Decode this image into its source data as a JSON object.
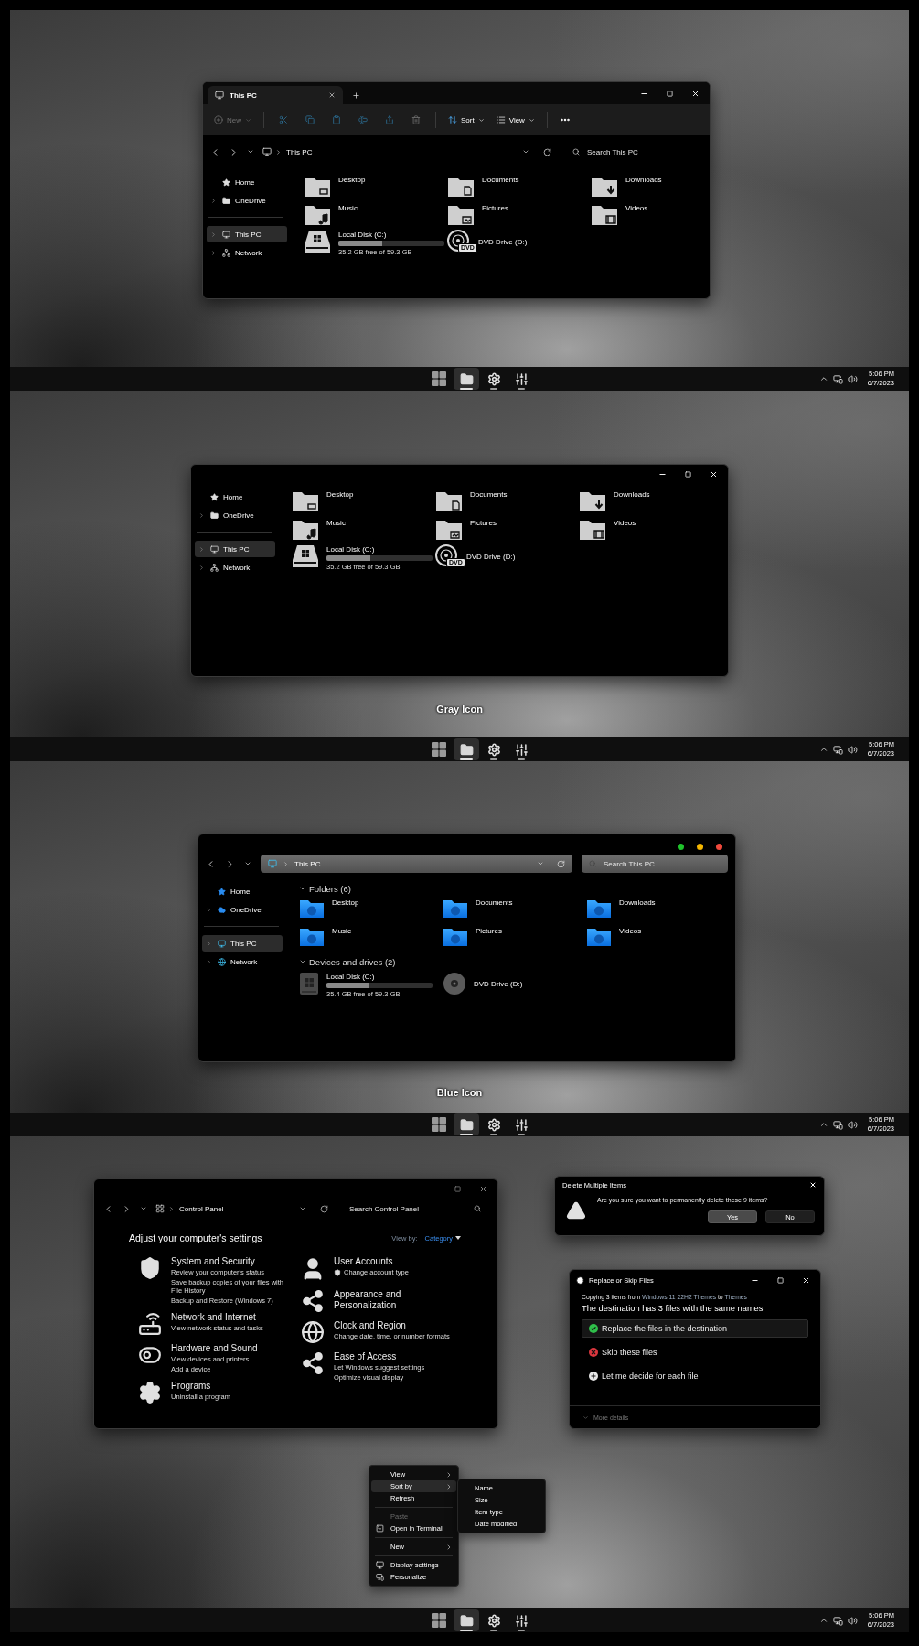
{
  "screens": [
    {
      "kind": "tabbed_explorer",
      "tabs": [
        {
          "title": "This PC",
          "selected": true
        }
      ],
      "toolbar": {
        "new": {
          "label": "New",
          "disabled": true
        },
        "actions_disabled": true,
        "sort": "Sort",
        "view": "View"
      },
      "address": {
        "path": "This PC"
      },
      "search": {
        "placeholder": "Search This PC"
      },
      "sidebar": {
        "pinned": [
          {
            "label": "Home",
            "expandable": false,
            "selected": false
          },
          {
            "label": "OneDrive",
            "expandable": true,
            "selected": false
          }
        ],
        "devices": [
          {
            "label": "This PC",
            "expandable": true,
            "selected": true
          },
          {
            "label": "Network",
            "expandable": true,
            "selected": false
          }
        ]
      },
      "folders": [
        {
          "name": "Desktop"
        },
        {
          "name": "Documents"
        },
        {
          "name": "Downloads"
        },
        {
          "name": "Music"
        },
        {
          "name": "Pictures"
        },
        {
          "name": "Videos"
        }
      ],
      "drives": [
        {
          "kind": "disk",
          "name": "Local Disk (C:)",
          "level": 0.41,
          "space": "35.2 GB free of 59.3 GB"
        },
        {
          "kind": "optical",
          "name": "DVD Drive (D:)",
          "badge": "DVD"
        }
      ],
      "taskbar": {
        "apps": [
          {
            "selected": false,
            "running": false
          },
          {
            "selected": true,
            "running": true
          },
          {
            "selected": false,
            "running": true
          },
          {
            "selected": false,
            "running": true
          }
        ],
        "time": "5:06 PM",
        "date": "6/7/2023"
      }
    },
    {
      "kind": "plain_explorer",
      "caption": "Gray Icon",
      "sidebar": {
        "pinned": [
          {
            "label": "Home",
            "expandable": false,
            "selected": false
          },
          {
            "label": "OneDrive",
            "expandable": true,
            "selected": false
          }
        ],
        "devices": [
          {
            "label": "This PC",
            "expandable": true,
            "selected": true
          },
          {
            "label": "Network",
            "expandable": true,
            "selected": false
          }
        ]
      },
      "folders": [
        {
          "name": "Desktop"
        },
        {
          "name": "Documents"
        },
        {
          "name": "Downloads"
        },
        {
          "name": "Music"
        },
        {
          "name": "Pictures"
        },
        {
          "name": "Videos"
        }
      ],
      "drives": [
        {
          "kind": "disk",
          "name": "Local Disk (C:)",
          "level": 0.41,
          "space": "35.2 GB free of 59.3 GB"
        },
        {
          "kind": "optical",
          "name": "DVD Drive (D:)",
          "badge": "DVD"
        }
      ],
      "taskbar": {
        "apps": [
          {
            "selected": false,
            "running": false
          },
          {
            "selected": true,
            "running": true
          },
          {
            "selected": false,
            "running": true
          },
          {
            "selected": false,
            "running": true
          }
        ],
        "time": "5:06 PM",
        "date": "6/7/2023"
      }
    },
    {
      "kind": "blue_explorer",
      "caption": "Blue Icon",
      "window_buttons": [
        {
          "color": "#1fc32b"
        },
        {
          "color": "#f5b700"
        },
        {
          "color": "#f0493c"
        }
      ],
      "address": {
        "path": "This PC"
      },
      "search": {
        "placeholder": "Search This PC"
      },
      "sidebar": {
        "pinned": [
          {
            "label": "Home",
            "expandable": false,
            "selected": false
          },
          {
            "label": "OneDrive",
            "expandable": true,
            "selected": false
          }
        ],
        "devices": [
          {
            "label": "This PC",
            "expandable": true,
            "selected": true
          },
          {
            "label": "Network",
            "expandable": true,
            "selected": false
          }
        ]
      },
      "sections": {
        "folders": "Folders (6)",
        "drives": "Devices and drives (2)"
      },
      "folders": [
        {
          "name": "Desktop"
        },
        {
          "name": "Documents"
        },
        {
          "name": "Downloads"
        },
        {
          "name": "Music"
        },
        {
          "name": "Pictures"
        },
        {
          "name": "Videos"
        }
      ],
      "drives": [
        {
          "kind": "disk",
          "name": "Local Disk (C:)",
          "level": 0.4,
          "space": "35.4 GB free of 59.3 GB"
        },
        {
          "kind": "optical",
          "name": "DVD Drive (D:)"
        }
      ],
      "taskbar": {
        "apps": [
          {
            "selected": false,
            "running": false
          },
          {
            "selected": true,
            "running": true
          },
          {
            "selected": false,
            "running": true
          },
          {
            "selected": false,
            "running": true
          }
        ],
        "time": "5:06 PM",
        "date": "6/7/2023"
      }
    },
    {
      "kind": "dialogs",
      "control_panel": {
        "address": {
          "path": "Control Panel"
        },
        "search": {
          "placeholder": "Search Control Panel"
        },
        "heading": "Adjust your computer's settings",
        "view_by": {
          "label": "View by:",
          "value": "Category"
        },
        "left": [
          {
            "title": "System and Security",
            "links": [
              {
                "text": "Review your computer's status",
                "shielded": false
              },
              {
                "text": "Save backup copies of your files with File History",
                "shielded": false
              },
              {
                "text": "Backup and Restore (Windows 7)",
                "shielded": false
              }
            ]
          },
          {
            "title": "Network and Internet",
            "links": [
              {
                "text": "View network status and tasks",
                "shielded": false
              }
            ]
          },
          {
            "title": "Hardware and Sound",
            "links": [
              {
                "text": "View devices and printers",
                "shielded": false
              },
              {
                "text": "Add a device",
                "shielded": false
              }
            ]
          },
          {
            "title": "Programs",
            "links": [
              {
                "text": "Uninstall a program",
                "shielded": false
              }
            ]
          }
        ],
        "right": [
          {
            "title": "User Accounts",
            "links": [
              {
                "text": "Change account type",
                "shielded": true
              }
            ]
          },
          {
            "title": "Appearance and Personalization"
          },
          {
            "title": "Clock and Region",
            "links": [
              {
                "text": "Change date, time, or number formats",
                "shielded": false
              }
            ]
          },
          {
            "title": "Ease of Access",
            "links": [
              {
                "text": "Let Windows suggest settings",
                "shielded": false
              },
              {
                "text": "Optimize visual display",
                "shielded": false
              }
            ]
          }
        ]
      },
      "delete_dialog": {
        "title": "Delete Multiple Items",
        "message": "Are you sure you want to permanently delete these 9 items?",
        "buttons": [
          {
            "label": "Yes",
            "selected": true
          },
          {
            "label": "No",
            "selected": false
          }
        ]
      },
      "replace_dialog": {
        "title": "Replace or Skip Files",
        "copying": {
          "prefix": "Copying 3 items from",
          "source": "Windows 11 22H2 Themes",
          "middle": "to",
          "target": "Themes"
        },
        "headline": "The destination has 3 files with the same names",
        "options": [
          {
            "label": "Replace the files in the destination",
            "selected": true,
            "color": "#2fbf4a"
          },
          {
            "label": "Skip these files",
            "selected": false,
            "color": "#d9363e"
          },
          {
            "label": "Let me decide for each file",
            "selected": false,
            "color": "#e6e6e6"
          }
        ],
        "more": "More details"
      },
      "context_menu": {
        "items": [
          {
            "kind": "item",
            "label": "View",
            "submenu": true,
            "selected": false,
            "disabled": false,
            "has_icon": false
          },
          {
            "kind": "item",
            "label": "Sort by",
            "submenu": true,
            "selected": true,
            "disabled": false,
            "has_icon": false
          },
          {
            "kind": "item",
            "label": "Refresh",
            "submenu": false,
            "selected": false,
            "disabled": false,
            "has_icon": false
          },
          {
            "kind": "separator"
          },
          {
            "kind": "item",
            "label": "Paste",
            "submenu": false,
            "selected": false,
            "disabled": true,
            "has_icon": false
          },
          {
            "kind": "item",
            "label": "Open in Terminal",
            "submenu": false,
            "selected": false,
            "disabled": false,
            "has_icon": true
          },
          {
            "kind": "separator"
          },
          {
            "kind": "item",
            "label": "New",
            "submenu": true,
            "selected": false,
            "disabled": false,
            "has_icon": false
          },
          {
            "kind": "separator"
          },
          {
            "kind": "item",
            "label": "Display settings",
            "submenu": false,
            "selected": false,
            "disabled": false,
            "has_icon": true
          },
          {
            "kind": "item",
            "label": "Personalize",
            "submenu": false,
            "selected": false,
            "disabled": false,
            "has_icon": true
          }
        ],
        "submenu": [
          "Name",
          "Size",
          "Item type",
          "Date modified"
        ]
      },
      "taskbar": {
        "apps": [
          {
            "selected": false,
            "running": false
          },
          {
            "selected": true,
            "running": true
          },
          {
            "selected": false,
            "running": true
          },
          {
            "selected": false,
            "running": true
          }
        ],
        "time": "5:06 PM",
        "date": "6/7/2023"
      }
    }
  ]
}
